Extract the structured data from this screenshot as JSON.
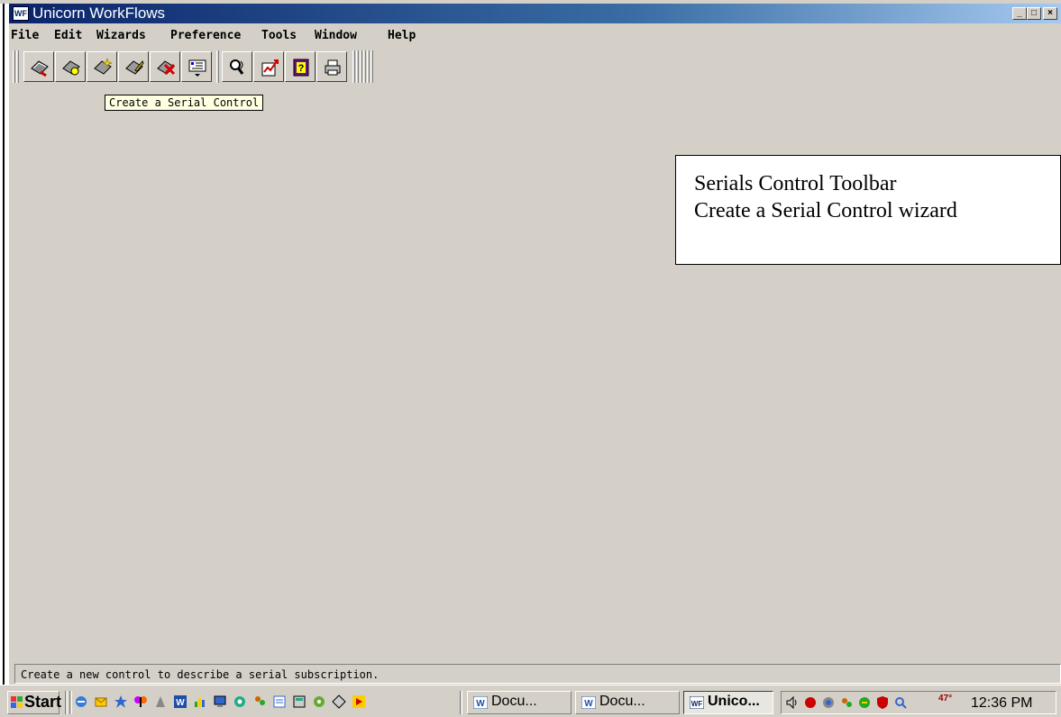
{
  "window": {
    "title": "Unicorn WorkFlows",
    "app_icon_text": "WF",
    "caption_buttons": {
      "minimize": "_",
      "maximize": "□",
      "close": "×"
    }
  },
  "menu": [
    "File",
    "Edit",
    "Wizards",
    "Preference",
    "Tools",
    "Window",
    "Help"
  ],
  "toolbar": {
    "buttons": [
      {
        "name": "check-in-icon"
      },
      {
        "name": "search-control-icon"
      },
      {
        "name": "create-serial-control-icon"
      },
      {
        "name": "edit-control-icon"
      },
      {
        "name": "delete-control-icon"
      },
      {
        "name": "display-dropdown-icon"
      },
      {
        "name": "search-magnifier-icon"
      },
      {
        "name": "report-icon"
      },
      {
        "name": "help-icon"
      },
      {
        "name": "print-icon"
      }
    ]
  },
  "tooltip": "Create a Serial Control",
  "annotation": {
    "line1": "Serials Control Toolbar",
    "line2": "Create a Serial Control wizard"
  },
  "status_bar": "Create a new control to describe a serial subscription.",
  "taskbar": {
    "start_label": "Start",
    "tasks": [
      {
        "label": "Docu...",
        "active": false
      },
      {
        "label": "Docu...",
        "active": false
      },
      {
        "label": "Unico...",
        "active": true
      }
    ],
    "tray_temp": "47°",
    "clock": "12:36 PM"
  },
  "colors": {
    "titlebar_start": "#0a246a",
    "titlebar_end": "#a6caf0",
    "window_bg": "#d4d0c8",
    "tooltip_bg": "#ffffe1"
  }
}
